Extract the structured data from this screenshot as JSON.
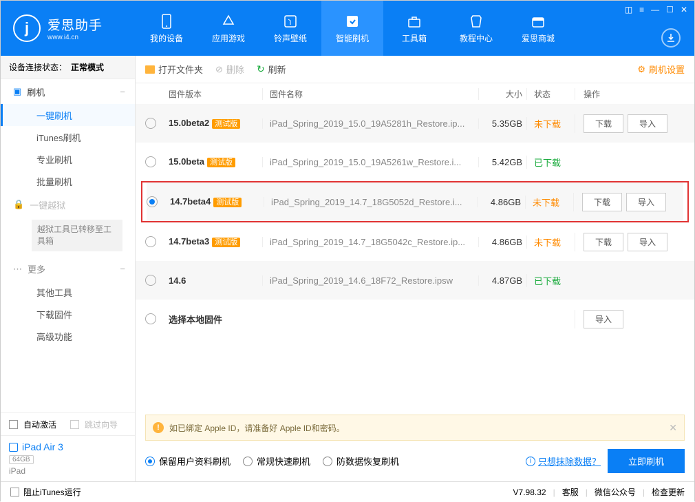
{
  "app": {
    "name_cn": "爱思助手",
    "url": "www.i4.cn"
  },
  "nav": [
    {
      "label": "我的设备"
    },
    {
      "label": "应用游戏"
    },
    {
      "label": "铃声壁纸"
    },
    {
      "label": "智能刷机"
    },
    {
      "label": "工具箱"
    },
    {
      "label": "教程中心"
    },
    {
      "label": "爱思商城"
    }
  ],
  "sidebar": {
    "status_label": "设备连接状态：",
    "status_value": "正常模式",
    "sec1": {
      "head": "刷机",
      "items": [
        "一键刷机",
        "iTunes刷机",
        "专业刷机",
        "批量刷机"
      ]
    },
    "sec2": {
      "head": "一键越狱",
      "banner": "越狱工具已转移至工具箱"
    },
    "sec3": {
      "head": "更多",
      "items": [
        "其他工具",
        "下载固件",
        "高级功能"
      ]
    },
    "auto_activate": "自动激活",
    "skip_guide": "跳过向导",
    "device_name": "iPad Air 3",
    "storage": "64GB",
    "device_type": "iPad"
  },
  "toolbar": {
    "open": "打开文件夹",
    "del": "删除",
    "refresh": "刷新",
    "settings": "刷机设置"
  },
  "columns": {
    "ver": "固件版本",
    "name": "固件名称",
    "size": "大小",
    "status": "状态",
    "act": "操作"
  },
  "rows": [
    {
      "ver": "15.0beta2",
      "badge": "测试版",
      "name": "iPad_Spring_2019_15.0_19A5281h_Restore.ip...",
      "size": "5.35GB",
      "status": "未下载",
      "dl": true,
      "imp": true,
      "alt": true
    },
    {
      "ver": "15.0beta",
      "badge": "测试版",
      "name": "iPad_Spring_2019_15.0_19A5261w_Restore.i...",
      "size": "5.42GB",
      "status": "已下载",
      "dl": false,
      "imp": false,
      "alt": false
    },
    {
      "ver": "14.7beta4",
      "badge": "测试版",
      "name": "iPad_Spring_2019_14.7_18G5052d_Restore.i...",
      "size": "4.86GB",
      "status": "未下载",
      "dl": true,
      "imp": true,
      "alt": true,
      "selected": true,
      "highlight": true
    },
    {
      "ver": "14.7beta3",
      "badge": "测试版",
      "name": "iPad_Spring_2019_14.7_18G5042c_Restore.ip...",
      "size": "4.86GB",
      "status": "未下载",
      "dl": true,
      "imp": true,
      "alt": false
    },
    {
      "ver": "14.6",
      "badge": "",
      "name": "iPad_Spring_2019_14.6_18F72_Restore.ipsw",
      "size": "4.87GB",
      "status": "已下载",
      "dl": false,
      "imp": false,
      "alt": true
    },
    {
      "ver": "选择本地固件",
      "badge": "",
      "name": "",
      "size": "",
      "status": "",
      "dl": false,
      "imp": true,
      "alt": false
    }
  ],
  "buttons": {
    "download": "下载",
    "import": "导入"
  },
  "alert": "如已绑定 Apple ID，请准备好 Apple ID和密码。",
  "options": [
    "保留用户资料刷机",
    "常规快速刷机",
    "防数据恢复刷机"
  ],
  "erase_link": "只想抹除数据？",
  "flash": "立即刷机",
  "footer": {
    "block_itunes": "阻止iTunes运行",
    "version": "V7.98.32",
    "service": "客服",
    "wechat": "微信公众号",
    "update": "检查更新"
  }
}
